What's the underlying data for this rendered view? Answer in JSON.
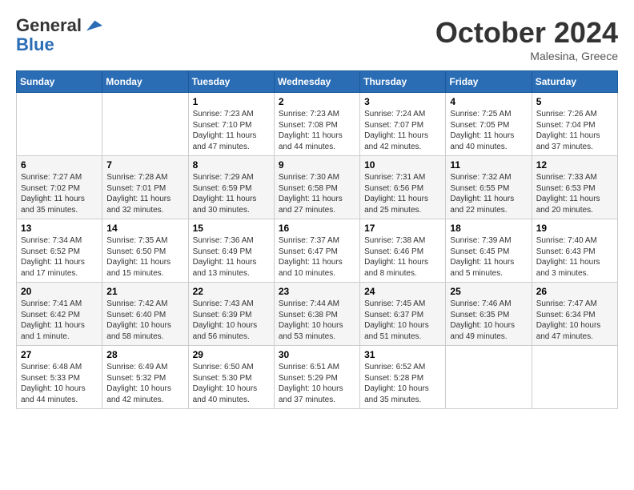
{
  "header": {
    "logo_line1": "General",
    "logo_line2": "Blue",
    "month_title": "October 2024",
    "location": "Malesina, Greece"
  },
  "days_of_week": [
    "Sunday",
    "Monday",
    "Tuesday",
    "Wednesday",
    "Thursday",
    "Friday",
    "Saturday"
  ],
  "weeks": [
    [
      {
        "num": "",
        "info": ""
      },
      {
        "num": "",
        "info": ""
      },
      {
        "num": "1",
        "info": "Sunrise: 7:23 AM\nSunset: 7:10 PM\nDaylight: 11 hours\nand 47 minutes."
      },
      {
        "num": "2",
        "info": "Sunrise: 7:23 AM\nSunset: 7:08 PM\nDaylight: 11 hours\nand 44 minutes."
      },
      {
        "num": "3",
        "info": "Sunrise: 7:24 AM\nSunset: 7:07 PM\nDaylight: 11 hours\nand 42 minutes."
      },
      {
        "num": "4",
        "info": "Sunrise: 7:25 AM\nSunset: 7:05 PM\nDaylight: 11 hours\nand 40 minutes."
      },
      {
        "num": "5",
        "info": "Sunrise: 7:26 AM\nSunset: 7:04 PM\nDaylight: 11 hours\nand 37 minutes."
      }
    ],
    [
      {
        "num": "6",
        "info": "Sunrise: 7:27 AM\nSunset: 7:02 PM\nDaylight: 11 hours\nand 35 minutes."
      },
      {
        "num": "7",
        "info": "Sunrise: 7:28 AM\nSunset: 7:01 PM\nDaylight: 11 hours\nand 32 minutes."
      },
      {
        "num": "8",
        "info": "Sunrise: 7:29 AM\nSunset: 6:59 PM\nDaylight: 11 hours\nand 30 minutes."
      },
      {
        "num": "9",
        "info": "Sunrise: 7:30 AM\nSunset: 6:58 PM\nDaylight: 11 hours\nand 27 minutes."
      },
      {
        "num": "10",
        "info": "Sunrise: 7:31 AM\nSunset: 6:56 PM\nDaylight: 11 hours\nand 25 minutes."
      },
      {
        "num": "11",
        "info": "Sunrise: 7:32 AM\nSunset: 6:55 PM\nDaylight: 11 hours\nand 22 minutes."
      },
      {
        "num": "12",
        "info": "Sunrise: 7:33 AM\nSunset: 6:53 PM\nDaylight: 11 hours\nand 20 minutes."
      }
    ],
    [
      {
        "num": "13",
        "info": "Sunrise: 7:34 AM\nSunset: 6:52 PM\nDaylight: 11 hours\nand 17 minutes."
      },
      {
        "num": "14",
        "info": "Sunrise: 7:35 AM\nSunset: 6:50 PM\nDaylight: 11 hours\nand 15 minutes."
      },
      {
        "num": "15",
        "info": "Sunrise: 7:36 AM\nSunset: 6:49 PM\nDaylight: 11 hours\nand 13 minutes."
      },
      {
        "num": "16",
        "info": "Sunrise: 7:37 AM\nSunset: 6:47 PM\nDaylight: 11 hours\nand 10 minutes."
      },
      {
        "num": "17",
        "info": "Sunrise: 7:38 AM\nSunset: 6:46 PM\nDaylight: 11 hours\nand 8 minutes."
      },
      {
        "num": "18",
        "info": "Sunrise: 7:39 AM\nSunset: 6:45 PM\nDaylight: 11 hours\nand 5 minutes."
      },
      {
        "num": "19",
        "info": "Sunrise: 7:40 AM\nSunset: 6:43 PM\nDaylight: 11 hours\nand 3 minutes."
      }
    ],
    [
      {
        "num": "20",
        "info": "Sunrise: 7:41 AM\nSunset: 6:42 PM\nDaylight: 11 hours\nand 1 minute."
      },
      {
        "num": "21",
        "info": "Sunrise: 7:42 AM\nSunset: 6:40 PM\nDaylight: 10 hours\nand 58 minutes."
      },
      {
        "num": "22",
        "info": "Sunrise: 7:43 AM\nSunset: 6:39 PM\nDaylight: 10 hours\nand 56 minutes."
      },
      {
        "num": "23",
        "info": "Sunrise: 7:44 AM\nSunset: 6:38 PM\nDaylight: 10 hours\nand 53 minutes."
      },
      {
        "num": "24",
        "info": "Sunrise: 7:45 AM\nSunset: 6:37 PM\nDaylight: 10 hours\nand 51 minutes."
      },
      {
        "num": "25",
        "info": "Sunrise: 7:46 AM\nSunset: 6:35 PM\nDaylight: 10 hours\nand 49 minutes."
      },
      {
        "num": "26",
        "info": "Sunrise: 7:47 AM\nSunset: 6:34 PM\nDaylight: 10 hours\nand 47 minutes."
      }
    ],
    [
      {
        "num": "27",
        "info": "Sunrise: 6:48 AM\nSunset: 5:33 PM\nDaylight: 10 hours\nand 44 minutes."
      },
      {
        "num": "28",
        "info": "Sunrise: 6:49 AM\nSunset: 5:32 PM\nDaylight: 10 hours\nand 42 minutes."
      },
      {
        "num": "29",
        "info": "Sunrise: 6:50 AM\nSunset: 5:30 PM\nDaylight: 10 hours\nand 40 minutes."
      },
      {
        "num": "30",
        "info": "Sunrise: 6:51 AM\nSunset: 5:29 PM\nDaylight: 10 hours\nand 37 minutes."
      },
      {
        "num": "31",
        "info": "Sunrise: 6:52 AM\nSunset: 5:28 PM\nDaylight: 10 hours\nand 35 minutes."
      },
      {
        "num": "",
        "info": ""
      },
      {
        "num": "",
        "info": ""
      }
    ]
  ]
}
